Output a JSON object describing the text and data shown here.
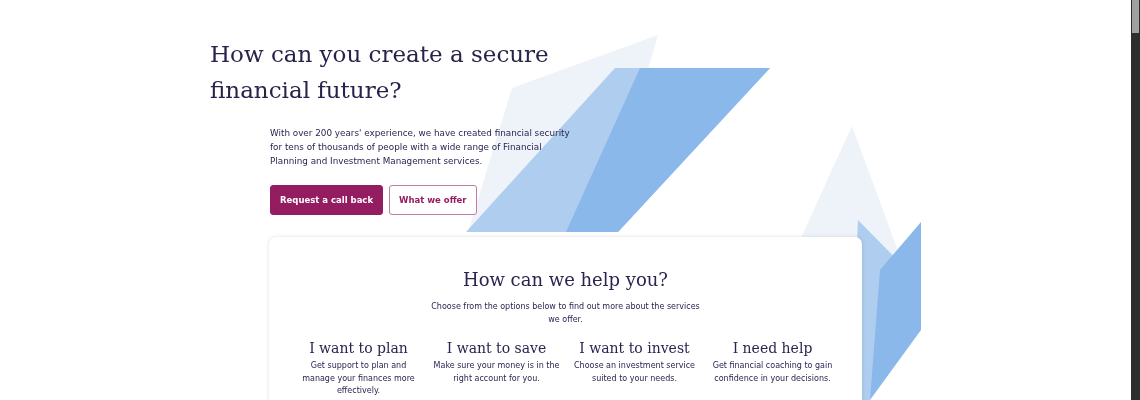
{
  "hero": {
    "title": "How can you create a secure financial future?",
    "intro": "With over 200 years' experience, we have created financial security for tens of thousands of people with a wide range of Financial Planning and Investment Management services.",
    "buttons": [
      {
        "label": "Request a call back",
        "kind": "primary"
      },
      {
        "label": "What we offer",
        "kind": "outline"
      }
    ]
  },
  "help": {
    "title": "How can we help you?",
    "subtitle": "Choose from the options below to find out more about the services we offer.",
    "options": [
      {
        "title": "I want to plan",
        "text": "Get support to plan and manage your finances more effectively."
      },
      {
        "title": "I want to save",
        "text": "Make sure your money is in the right account for you."
      },
      {
        "title": "I want to invest",
        "text": "Choose an investment service suited to your needs."
      },
      {
        "title": "I need help",
        "text": "Get financial coaching to gain confidence in your decisions."
      }
    ]
  }
}
